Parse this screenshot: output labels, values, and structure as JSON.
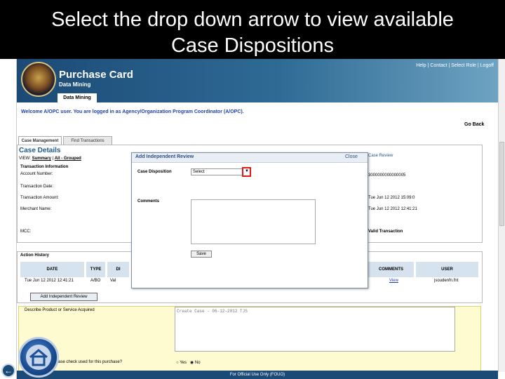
{
  "slide": {
    "title_line1": "Select the drop down arrow to view available",
    "title_line2": "Case Dispositions"
  },
  "app": {
    "name": "Purchase Card",
    "subtitle": "Data Mining",
    "top_links": "Help | Contact | Select Role | Logoff",
    "nav_tab": "Data Mining",
    "welcome": "Welcome A/OPC user. You are logged in as Agency/Organization Program Coordinator (A/OPC).",
    "go_back": "Go Back",
    "footer": "For Official Use Only (FOUO)"
  },
  "tabs": [
    {
      "label": "Case Management"
    },
    {
      "label": "Find Transactions"
    }
  ],
  "case_details": {
    "title": "Case Details",
    "view_label": "VIEW:",
    "view_summary": "Summary",
    "view_all": "All - Grouped",
    "tx_info": "Transaction Information",
    "fields": [
      {
        "label": "Account Number:"
      },
      {
        "label": "Transaction Date:"
      },
      {
        "label": "Transaction Amount:"
      },
      {
        "label": "Merchant Name:"
      },
      {
        "label": "MCC:"
      }
    ],
    "right_values": [
      "Case Review",
      "3000000000000005",
      "Tue Jun 12 2012 15:09:0",
      "Tue Jun 12 2012 12:41:21",
      "Valid Transaction"
    ]
  },
  "action_history": {
    "title": "Action History",
    "columns": [
      "DATE",
      "TYPE",
      "DI",
      "COMMENTS",
      "USER"
    ],
    "row": {
      "date": "Tue Jun 12 2012 12:41:21",
      "type": "A/BO",
      "di": "Val",
      "comments": "View",
      "user": "jsoudenfn.fnt"
    },
    "add_review_button": "Add Independent Review"
  },
  "describe": {
    "label": "Describe Product or Service Acquired",
    "text": "Create Case - 06-12-2012 TJS",
    "question": "ase check used for this purchase?",
    "yes": "Yes",
    "no": "No"
  },
  "modal": {
    "title": "Add Independent Review",
    "close_text": "Close",
    "disposition_label": "Case Disposition",
    "disposition_value": "Select",
    "comments_label": "Comments",
    "save_label": "Save"
  },
  "colors": {
    "header_dark": "#1b4a76",
    "highlight": "#e21a1a",
    "describe_bg": "#fffbd0"
  },
  "icons": {
    "home": "home-icon",
    "back": "back-arrow-icon",
    "dropdown": "chevron-down-icon"
  }
}
